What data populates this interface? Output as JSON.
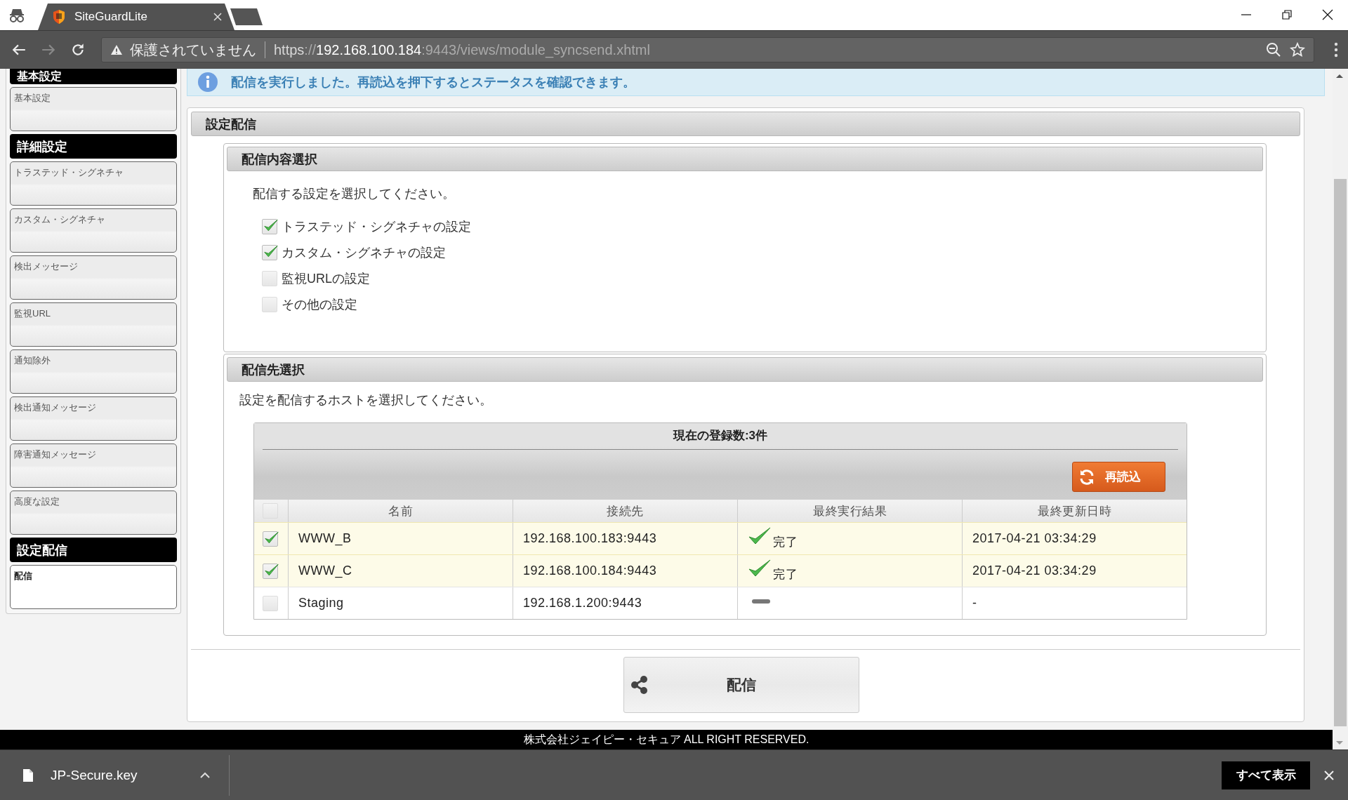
{
  "browser": {
    "tab_title": "SiteGuardLite",
    "security_label": "保護されていません",
    "url_scheme": "https",
    "url_separator": "://",
    "url_host": "192.168.100.184",
    "url_rest": ":9443/views/module_syncsend.xhtml"
  },
  "sidebar": {
    "groups": [
      {
        "title": "基本設定",
        "items": [
          {
            "label": "基本設定",
            "selected": false
          }
        ]
      },
      {
        "title": "詳細設定",
        "items": [
          {
            "label": "トラステッド・シグネチャ",
            "selected": false
          },
          {
            "label": "カスタム・シグネチャ",
            "selected": false
          },
          {
            "label": "検出メッセージ",
            "selected": false
          },
          {
            "label": "監視URL",
            "selected": false
          },
          {
            "label": "通知除外",
            "selected": false
          },
          {
            "label": "検出通知メッセージ",
            "selected": false
          },
          {
            "label": "障害通知メッセージ",
            "selected": false
          },
          {
            "label": "高度な設定",
            "selected": false
          }
        ]
      },
      {
        "title": "設定配信",
        "items": [
          {
            "label": "配信",
            "selected": true
          }
        ]
      }
    ]
  },
  "info_message": "配信を実行しました。再読込を押下するとステータスを確認できます。",
  "panel": {
    "title": "設定配信",
    "content_section": {
      "title": "配信内容選択",
      "instruction": "配信する設定を選択してください。",
      "options": [
        {
          "label": "トラステッド・シグネチャの設定",
          "checked": true
        },
        {
          "label": "カスタム・シグネチャの設定",
          "checked": true
        },
        {
          "label": "監視URLの設定",
          "checked": false
        },
        {
          "label": "その他の設定",
          "checked": false
        }
      ]
    },
    "target_section": {
      "title": "配信先選択",
      "instruction": "設定を配信するホストを選択してください。",
      "table": {
        "caption": "現在の登録数:3件",
        "reload_button": "再読込",
        "header_checked": false,
        "columns": [
          "名前",
          "接続先",
          "最終実行結果",
          "最終更新日時"
        ],
        "rows": [
          {
            "checked": true,
            "name": "WWW_B",
            "address": "192.168.100.183:9443",
            "result": {
              "kind": "done",
              "label": "完了"
            },
            "updated": "2017-04-21 03:34:29"
          },
          {
            "checked": true,
            "name": "WWW_C",
            "address": "192.168.100.184:9443",
            "result": {
              "kind": "done",
              "label": "完了"
            },
            "updated": "2017-04-21 03:34:29"
          },
          {
            "checked": false,
            "name": "Staging",
            "address": "192.168.1.200:9443",
            "result": {
              "kind": "none"
            },
            "updated": "-"
          }
        ]
      }
    },
    "send_button": "配信"
  },
  "footer": "株式会社ジェイピー・セキュア ALL RIGHT RESERVED.",
  "download_bar": {
    "file_name": "JP-Secure.key",
    "show_all_button": "すべて表示"
  }
}
